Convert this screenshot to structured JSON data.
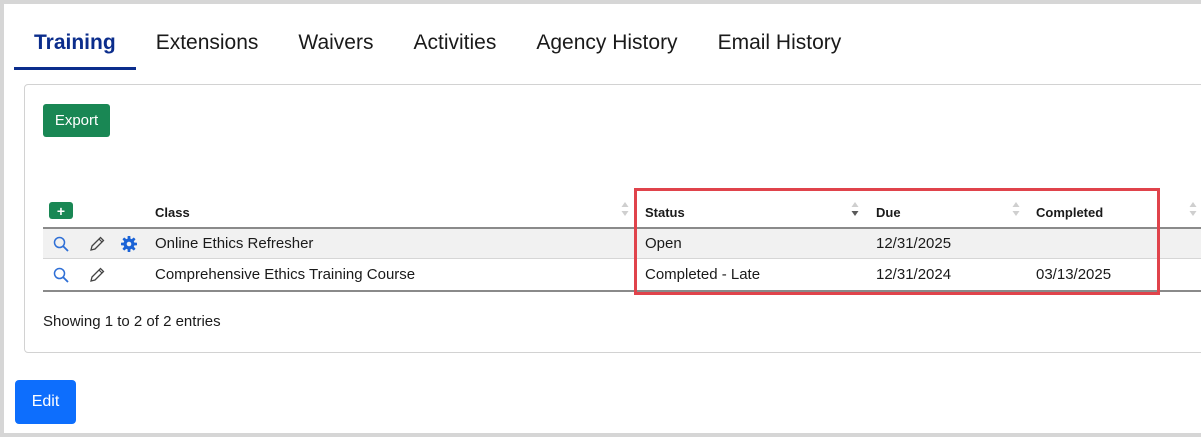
{
  "tabs": [
    {
      "label": "Training",
      "active": true
    },
    {
      "label": "Extensions",
      "active": false
    },
    {
      "label": "Waivers",
      "active": false
    },
    {
      "label": "Activities",
      "active": false
    },
    {
      "label": "Agency History",
      "active": false
    },
    {
      "label": "Email History",
      "active": false
    }
  ],
  "toolbar": {
    "export_label": "Export",
    "add_label": "+"
  },
  "table": {
    "columns": [
      "Class",
      "Status",
      "Due",
      "Completed"
    ],
    "rows": [
      {
        "class": "Online Ethics Refresher",
        "status": "Open",
        "due": "12/31/2025",
        "completed": "",
        "icons": [
          "search-icon",
          "pencil-icon",
          "gear-icon"
        ]
      },
      {
        "class": "Comprehensive Ethics Training Course",
        "status": "Completed - Late",
        "due": "12/31/2024",
        "completed": "03/13/2025",
        "icons": [
          "search-icon",
          "pencil-icon"
        ]
      }
    ],
    "info": "Showing 1 to 2 of 2 entries"
  },
  "footer": {
    "edit_label": "Edit"
  },
  "colors": {
    "accent_tab": "#0b2d8c",
    "export_green": "#198754",
    "edit_blue": "#0d6efd",
    "highlight_red": "#e0434b"
  }
}
